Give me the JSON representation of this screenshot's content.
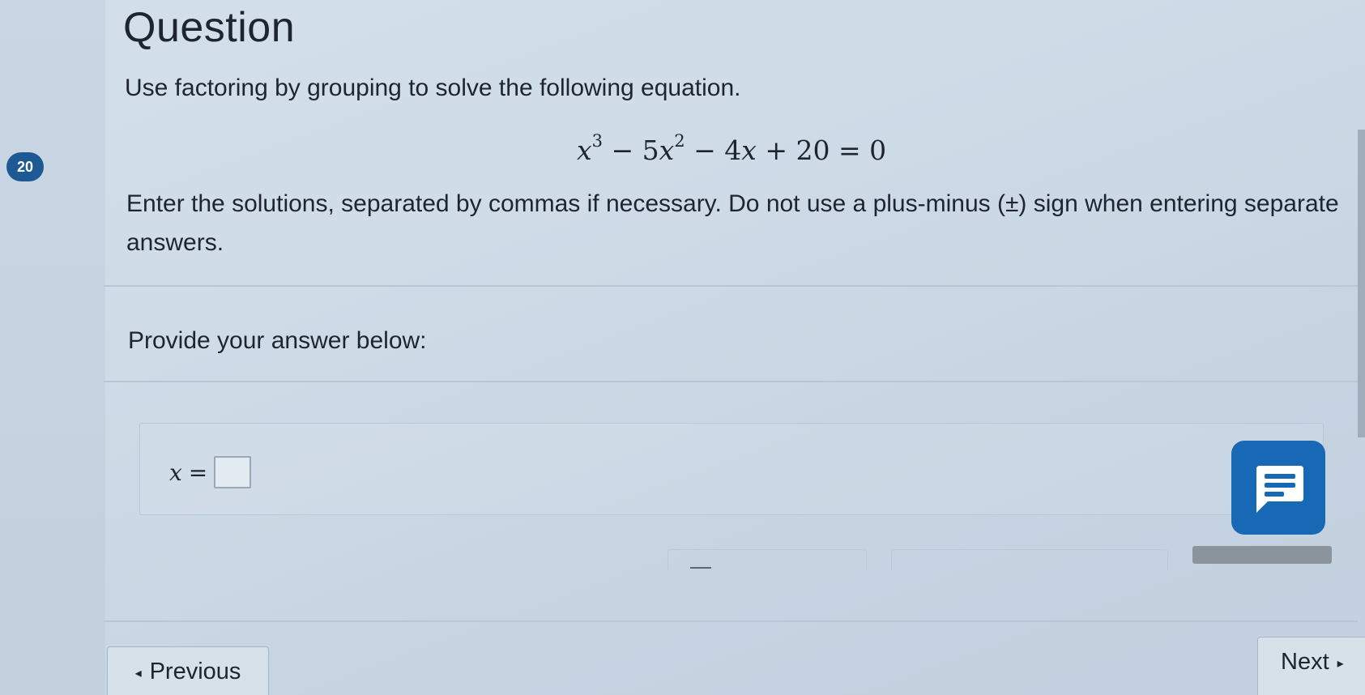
{
  "question": {
    "number": "20",
    "title": "Question",
    "instruction": "Use factoring by grouping to solve the following equation.",
    "equation": {
      "t1_base": "x",
      "t1_exp": "3",
      "t2": " − 5",
      "t2_var": "x",
      "t2_exp": "2",
      "t3": " − 4",
      "t3_var": "x",
      "t4": " + 20 = 0"
    },
    "directions": "Enter the solutions, separated by commas if necessary. Do not use a plus-minus (±) sign when entering separate answers."
  },
  "answer": {
    "prompt": "Provide your answer below:",
    "variable": "x",
    "equals": "=",
    "value": ""
  },
  "navigation": {
    "previous_label": "Previous",
    "previous_icon": "◂",
    "next_label": "Next",
    "next_icon": "▸"
  },
  "icons": {
    "chat": "chat-bubble-icon"
  },
  "colors": {
    "badge": "#1d5a93",
    "chat_button": "#1769b5"
  }
}
